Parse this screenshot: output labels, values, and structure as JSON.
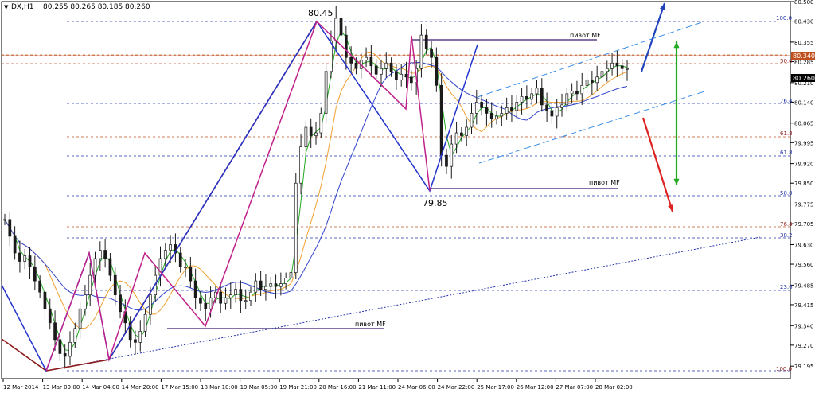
{
  "header": {
    "symbol_timeframe": "DX,H1",
    "ohlc": "80.255 80.265 80.185 80.260"
  },
  "colors": {
    "background": "#ffffff",
    "candle_up": "#1a1a1a",
    "candle_down": "#1a1a1a",
    "ma_fast": "#22aa22",
    "ma_mid": "#f0a030",
    "ma_slow": "#3344cc",
    "fib_lines": "#2233aa",
    "pivot_lines": "#3a1a6a",
    "zigzag_magenta": "#c0208a",
    "zigzag_blue": "#2233cc",
    "zigzag_darkred": "#8b1a1a",
    "channel": "#3a8ee6",
    "arrow_up": "#2244bb",
    "arrow_down": "#dd2222",
    "arrow_double": "#22aa22",
    "price_line": "#c05020"
  },
  "chart_data": {
    "type": "candlestick",
    "ylim": [
      79.15,
      80.5
    ],
    "y_ticks": [
      "80.500",
      "80.430",
      "80.355",
      "80.285",
      "80.210",
      "80.140",
      "80.065",
      "79.995",
      "79.920",
      "79.850",
      "79.775",
      "79.705",
      "79.630",
      "79.560",
      "79.485",
      "79.415",
      "79.340",
      "79.270",
      "79.195"
    ],
    "x_ticks": [
      "12 Mar 2014",
      "13 Mar 09:00",
      "14 Mar 04:00",
      "14 Mar 20:00",
      "17 Mar 15:00",
      "18 Mar 10:00",
      "19 Mar 05:00",
      "19 Mar 21:00",
      "20 Mar 16:00",
      "21 Mar 11:00",
      "24 Mar 06:00",
      "24 Mar 22:00",
      "25 Mar 17:00",
      "26 Mar 12:00",
      "27 Mar 07:00",
      "28 Mar 02:00"
    ],
    "current_price": "80.260",
    "price_level_label": "80.340",
    "close_series": [
      79.72,
      79.66,
      79.6,
      79.57,
      79.59,
      79.55,
      79.5,
      79.46,
      79.4,
      79.35,
      79.29,
      79.24,
      79.23,
      79.28,
      79.33,
      79.4,
      79.45,
      79.52,
      79.58,
      79.61,
      79.58,
      79.52,
      79.45,
      79.39,
      79.35,
      79.29,
      79.28,
      79.32,
      79.38,
      79.45,
      79.52,
      79.58,
      79.61,
      79.63,
      79.6,
      79.55,
      79.55,
      79.5,
      79.44,
      79.42,
      79.4,
      79.44,
      79.46,
      79.42,
      79.44,
      79.45,
      79.47,
      79.43,
      79.43,
      79.46,
      79.5,
      79.47,
      79.48,
      79.49,
      79.48,
      79.49,
      79.51,
      79.53,
      79.85,
      79.98,
      80.05,
      80.02,
      80.03,
      80.1,
      80.25,
      80.36,
      80.44,
      80.38,
      80.3,
      80.28,
      80.26,
      80.29,
      80.3,
      80.27,
      80.24,
      80.26,
      80.28,
      80.25,
      80.22,
      80.24,
      80.23,
      80.21,
      80.26,
      80.38,
      80.33,
      80.3,
      80.2,
      79.95,
      79.91,
      79.99,
      80.03,
      80.02,
      80.05,
      80.1,
      80.14,
      80.12,
      80.1,
      80.08,
      80.09,
      80.1,
      80.12,
      80.11,
      80.14,
      80.16,
      80.15,
      80.17,
      80.19,
      80.13,
      80.11,
      80.09,
      80.12,
      80.13,
      80.17,
      80.18,
      80.17,
      80.2,
      80.22,
      80.21,
      80.23,
      80.25,
      80.26,
      80.28,
      80.27,
      80.26,
      80.26
    ],
    "annotations": {
      "peak_label": "80.45",
      "trough_label": "79.85",
      "pivot_labels": [
        "пивот MF",
        "пивот MF",
        "пивот MF"
      ],
      "fib_labels_top": [
        "100.0",
        "50.0",
        "76.4",
        "61.8",
        "61.8",
        "50.0",
        "76.4",
        "38.2",
        "23.6",
        "100.0"
      ]
    }
  }
}
